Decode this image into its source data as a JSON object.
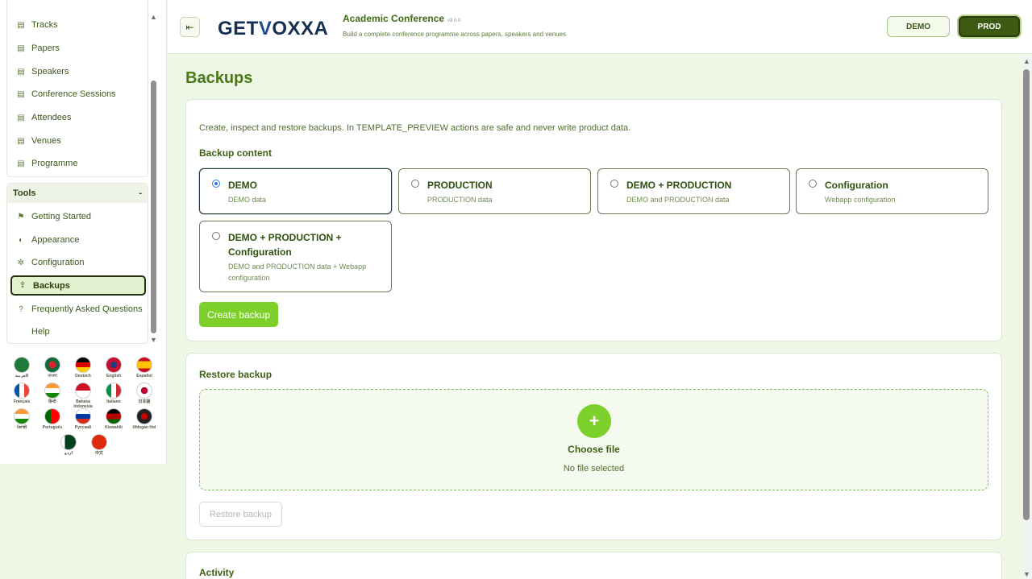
{
  "sidebar": {
    "nav_items": [
      {
        "label": "Tracks",
        "icon": "list-icon"
      },
      {
        "label": "Papers",
        "icon": "list-icon"
      },
      {
        "label": "Speakers",
        "icon": "list-icon"
      },
      {
        "label": "Conference Sessions",
        "icon": "list-icon"
      },
      {
        "label": "Attendees",
        "icon": "list-icon"
      },
      {
        "label": "Venues",
        "icon": "list-icon"
      },
      {
        "label": "Programme",
        "icon": "list-icon"
      }
    ],
    "tools": {
      "title": "Tools",
      "collapse_symbol": "-",
      "items": [
        {
          "label": "Getting Started",
          "icon": "flag-outline-icon"
        },
        {
          "label": "Appearance",
          "icon": "palette-icon"
        },
        {
          "label": "Configuration",
          "icon": "gear-icon"
        },
        {
          "label": "Backups",
          "icon": "upload-icon",
          "active": true
        },
        {
          "label": "Frequently Asked Questions",
          "icon": "question-icon"
        },
        {
          "label": "Help",
          "icon": ""
        }
      ]
    },
    "languages": [
      "العربية",
      "বাংলা",
      "Deutsch",
      "English",
      "Español",
      "Français",
      "हिन्दी",
      "Bahasa Indonesia",
      "Italiano",
      "日本語",
      "ਪੰਜਾਬੀ",
      "Português",
      "Русский",
      "Kiswahili",
      "tlhIngan Hol",
      "اردو",
      "中文"
    ]
  },
  "header": {
    "logo": "GETVOXXA",
    "app_title": "Academic Conference",
    "version": "v9.0.0",
    "subtitle": "Build a complete conference programme across papers, speakers and venues",
    "demo_label": "DEMO",
    "prod_label": "PROD"
  },
  "main": {
    "page_title": "Backups",
    "backup": {
      "description": "Create, inspect and restore backups. In TEMPLATE_PREVIEW actions are safe and never write product data.",
      "content_title": "Backup content",
      "options": [
        {
          "title": "DEMO",
          "subtitle": "DEMO data",
          "selected": true
        },
        {
          "title": "PRODUCTION",
          "subtitle": "PRODUCTION data",
          "selected": false
        },
        {
          "title": "DEMO + PRODUCTION",
          "subtitle": "DEMO and PRODUCTION data",
          "selected": false
        },
        {
          "title": "Configuration",
          "subtitle": "Webapp configuration",
          "selected": false
        },
        {
          "title": "DEMO + PRODUCTION + Configuration",
          "subtitle": "DEMO and PRODUCTION data + Webapp configuration",
          "selected": false
        }
      ],
      "create_label": "Create backup"
    },
    "restore": {
      "title": "Restore backup",
      "choose_label": "Choose file",
      "file_status": "No file selected",
      "restore_label": "Restore backup"
    },
    "activity": {
      "title": "Activity"
    }
  },
  "colors": {
    "accent": "#7dcf2a",
    "prod": "#3c5a12",
    "title": "#4a7a16"
  }
}
